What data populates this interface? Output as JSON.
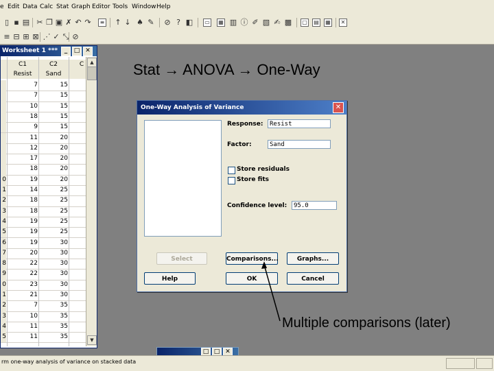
{
  "menubar": {
    "items": [
      "e",
      "Edit",
      "Data",
      "Calc",
      "Stat",
      "Graph",
      "Editor",
      "Tools",
      "Window",
      "Help"
    ]
  },
  "worksheet": {
    "title": "Worksheet 1 ***",
    "col_ids": [
      "C1",
      "C2",
      "C"
    ],
    "col_names": [
      "Resist",
      "Sand"
    ],
    "row_numbers": [
      "",
      "",
      "",
      "",
      "",
      "",
      "",
      "",
      "",
      "0",
      "1",
      "2",
      "3",
      "4",
      "5",
      "6",
      "7",
      "8",
      "9",
      "0",
      "1",
      "2",
      "3",
      "4",
      "5"
    ],
    "resist": [
      "7",
      "7",
      "10",
      "18",
      "9",
      "11",
      "12",
      "17",
      "18",
      "19",
      "14",
      "18",
      "18",
      "19",
      "19",
      "19",
      "20",
      "22",
      "22",
      "23",
      "21",
      "7",
      "10",
      "11",
      "11"
    ],
    "sand": [
      "15",
      "15",
      "15",
      "15",
      "15",
      "20",
      "20",
      "20",
      "20",
      "20",
      "25",
      "25",
      "25",
      "25",
      "25",
      "30",
      "30",
      "30",
      "30",
      "30",
      "30",
      "35",
      "35",
      "35",
      "35"
    ]
  },
  "slide": {
    "heading": "Stat → ANOVA → One-Way",
    "annotation": "Multiple comparisons (later)"
  },
  "dialog": {
    "title": "One-Way Analysis of Variance",
    "response_label": "Response:",
    "response_value": "Resist",
    "factor_label": "Factor:",
    "factor_value": "Sand",
    "store_residuals_label": "Store residuals",
    "store_fits_label": "Store fits",
    "confidence_label": "Confidence level:",
    "confidence_value": "95.0",
    "buttons": {
      "select": "Select",
      "comparisons": "Comparisons...",
      "graphs": "Graphs...",
      "help": "Help",
      "ok": "OK",
      "cancel": "Cancel"
    }
  },
  "status": {
    "text": "rm one-way analysis of variance on stacked data"
  },
  "colors": {
    "titlebar": "#0a246a",
    "chrome": "#ece9d8",
    "background": "#808080"
  }
}
